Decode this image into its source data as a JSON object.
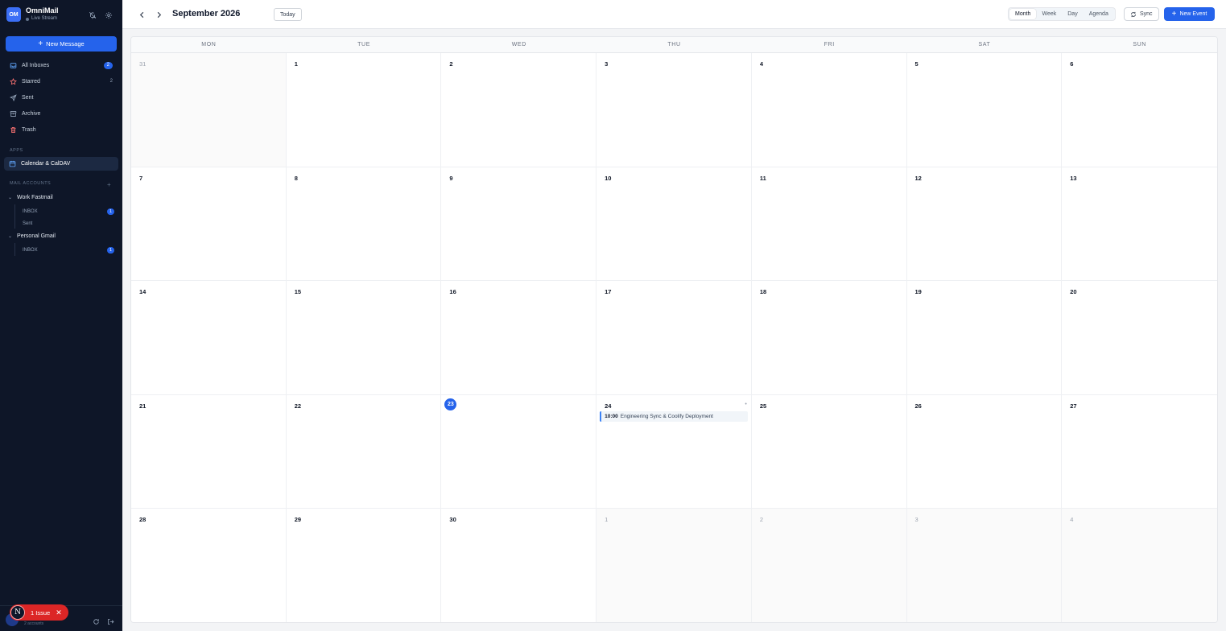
{
  "app": {
    "name": "OmniMail",
    "logo_initials": "OM",
    "status": "Live Stream"
  },
  "sidebar": {
    "compose_label": "New Message",
    "nav": [
      {
        "label": "All Inboxes",
        "icon": "inbox-icon",
        "count": "2",
        "pill": true
      },
      {
        "label": "Starred",
        "icon": "star-icon",
        "count": "2",
        "pill": false
      },
      {
        "label": "Sent",
        "icon": "send-icon",
        "count": "",
        "pill": false
      },
      {
        "label": "Archive",
        "icon": "archive-icon",
        "count": "",
        "pill": false
      },
      {
        "label": "Trash",
        "icon": "trash-icon",
        "count": "",
        "pill": false
      }
    ],
    "apps_label": "APPS",
    "apps": [
      {
        "label": "Calendar & CalDAV",
        "icon": "calendar-icon"
      }
    ],
    "accounts_label": "MAIL ACCOUNTS",
    "accounts": [
      {
        "name": "Work Fastmail",
        "folders": [
          {
            "label": "INBOX",
            "count": "1"
          },
          {
            "label": "Sent",
            "count": ""
          }
        ]
      },
      {
        "name": "Personal Gmail",
        "folders": [
          {
            "label": "INBOX",
            "count": "1"
          }
        ]
      }
    ],
    "footer_sub": "2 accounts"
  },
  "issue_badge": {
    "letter": "N",
    "label": "1 Issue"
  },
  "header": {
    "title": "September 2026",
    "today_label": "Today",
    "views": [
      "Month",
      "Week",
      "Day",
      "Agenda"
    ],
    "active_view": "Month",
    "sync_label": "Sync",
    "new_event_label": "New Event"
  },
  "calendar": {
    "weekdays": [
      "MON",
      "TUE",
      "WED",
      "THU",
      "FRI",
      "SAT",
      "SUN"
    ],
    "today": "23",
    "days": [
      {
        "n": "31",
        "other": true
      },
      {
        "n": "1"
      },
      {
        "n": "2"
      },
      {
        "n": "3"
      },
      {
        "n": "4"
      },
      {
        "n": "5"
      },
      {
        "n": "6"
      },
      {
        "n": "7"
      },
      {
        "n": "8"
      },
      {
        "n": "9"
      },
      {
        "n": "10"
      },
      {
        "n": "11"
      },
      {
        "n": "12"
      },
      {
        "n": "13"
      },
      {
        "n": "14"
      },
      {
        "n": "15"
      },
      {
        "n": "16"
      },
      {
        "n": "17"
      },
      {
        "n": "18"
      },
      {
        "n": "19"
      },
      {
        "n": "20"
      },
      {
        "n": "21"
      },
      {
        "n": "22"
      },
      {
        "n": "23",
        "today": true
      },
      {
        "n": "24",
        "more": true,
        "events": [
          {
            "time": "10:00",
            "title": "Engineering Sync & Coolify Deployment"
          }
        ]
      },
      {
        "n": "25"
      },
      {
        "n": "26"
      },
      {
        "n": "27"
      },
      {
        "n": "28"
      },
      {
        "n": "29"
      },
      {
        "n": "30"
      },
      {
        "n": "1",
        "other": true
      },
      {
        "n": "2",
        "other": true
      },
      {
        "n": "3",
        "other": true
      },
      {
        "n": "4",
        "other": true
      }
    ]
  },
  "colors": {
    "sidebar_bg": "#0e1628",
    "accent": "#2563eb",
    "issue_red": "#dc2626"
  }
}
